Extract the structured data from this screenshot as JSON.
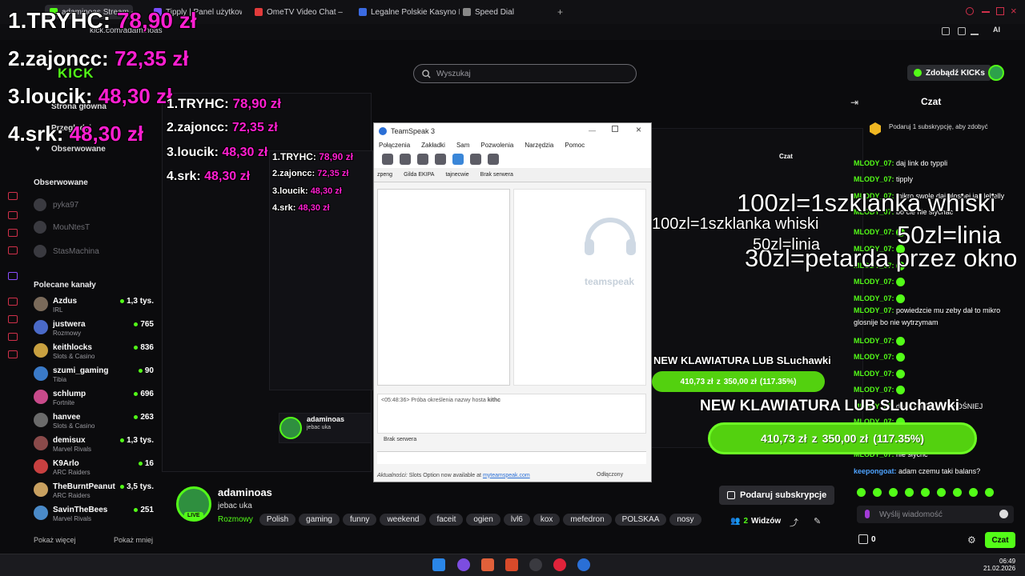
{
  "browser": {
    "tabs": [
      {
        "label": "adaminoas Stream - Wat",
        "color": "#53fc18"
      },
      {
        "label": "Tipply | Panel użytkownik",
        "color": "#7a4dff"
      },
      {
        "label": "OmeTV Video Chat –",
        "color": "#e23b3b"
      },
      {
        "label": "Legalne Polskie Kasyno In",
        "color": "#3b6be2"
      },
      {
        "label": "Speed Dial",
        "color": "#888888"
      }
    ],
    "url": "kick.com/adaminoas"
  },
  "header": {
    "search_placeholder": "Wyszukaj",
    "kicks_button": "Zdobądź KICKs",
    "logo": "KICK",
    "accent": "#53fc18"
  },
  "overlay": {
    "leaderboard": [
      {
        "name": "1.TRYHC:",
        "value": "78,90 zł"
      },
      {
        "name": "2.zajoncc:",
        "value": "72,35 zł"
      },
      {
        "name": "3.loucik:",
        "value": "48,30 zł"
      },
      {
        "name": "4.srk:",
        "value": "48,30 zł"
      }
    ],
    "price_lines": [
      "100zl=1szklanka whiski",
      "50zl=linia",
      "30zl=petarda przez okno"
    ],
    "goal_title": "NEW KLAWIATURA LUB SLuchawki",
    "goal_current": "410,73 zł",
    "goal_sep": "z",
    "goal_target": "350,00 zł",
    "goal_pct": "(117.35%)"
  },
  "sidebar": {
    "nav_home": "Strona główna",
    "nav_browse": "Przeglądaj",
    "nav_following": "Obserwowane",
    "following_header": "Obserwowane",
    "following": [
      "pyka97",
      "MouNtesT",
      "StasMachina"
    ],
    "recommended_header": "Polecane kanały",
    "recommended": [
      {
        "name": "Azdus",
        "cat": "IRL",
        "count": "1,3 tys."
      },
      {
        "name": "justwera",
        "cat": "Rozmowy",
        "count": "765"
      },
      {
        "name": "keithlocks",
        "cat": "Slots & Casino",
        "count": "836"
      },
      {
        "name": "szumi_gaming",
        "cat": "Tibia",
        "count": "90"
      },
      {
        "name": "schlump",
        "cat": "Fortnite",
        "count": "696"
      },
      {
        "name": "hanvee",
        "cat": "Slots & Casino",
        "count": "263"
      },
      {
        "name": "demisux",
        "cat": "Marvel Rivals",
        "count": "1,3 tys."
      },
      {
        "name": "K9Arlo",
        "cat": "ARC Raiders",
        "count": "16"
      },
      {
        "name": "TheBurntPeanut",
        "cat": "ARC Raiders",
        "count": "3,5 tys."
      },
      {
        "name": "SavinTheBees",
        "cat": "Marvel Rivals",
        "count": "251"
      }
    ],
    "show_more": "Pokaż więcej",
    "show_less": "Pokaż mniej"
  },
  "teamspeak": {
    "title": "TeamSpeak 3",
    "menu": [
      "Połączenia",
      "Zakładki",
      "Sam",
      "Pozwolenia",
      "Narzędzia",
      "Pomoc"
    ],
    "tabs": [
      "zpeng",
      "Gilda EKIPA",
      "tajnecwie",
      "Brak serwera"
    ],
    "log_line": "<05:48:36> Próba określenia nazwy hosta",
    "log_host": "kithc",
    "channel_label": "Brak serwera",
    "status_label": "Aktualności:",
    "status_text": "Slots Option now available at",
    "status_link": "myteamspeak.com",
    "status_right": "Odłączony",
    "brand": "teamspeak"
  },
  "chat": {
    "title": "Czat",
    "promo": "Podaruj 1 subskrypcję, aby zdobyć",
    "messages": [
      {
        "user": "MLODY_07:",
        "text": "daj link do typpli"
      },
      {
        "user": "MLODY_07:",
        "text": "tipply"
      },
      {
        "user": "MLODY_07:",
        "text": "mikro swole daj glosnej jak lebelly"
      },
      {
        "user": "MLODY_07:",
        "text": "bo cie nie slychac"
      },
      {
        "user": "MLODY_07:",
        "text": "powiedzcie mu zeby dał to mikro"
      },
      {
        "user": "",
        "text": "glosnije bo nie wytrzymam"
      },
      {
        "user": "MLODY_07:",
        "text": "da LTO MIKRO GŁOŚNIEJ"
      },
      {
        "user": "MLODY_07:",
        "text": "nie słychc"
      },
      {
        "user": "keepongoat:",
        "text": "adam czemu taki balans?"
      }
    ],
    "input_placeholder": "Wyślij wiadomość",
    "send_label": "Czat",
    "points": "0"
  },
  "stream": {
    "streamer": "adaminoas",
    "title": "jebac uka",
    "category": "Rozmowy",
    "tags": [
      "Polish",
      "gaming",
      "funny",
      "weekend",
      "faceit",
      "ogien",
      "lvl6",
      "kox",
      "mefedron",
      "POLSKAA",
      "nosy"
    ],
    "live_badge": "LIVE",
    "sub_button": "Podaruj subskrypcje",
    "viewers": "2",
    "viewers_label": "Widzów"
  },
  "taskbar": {
    "time": "06:49",
    "date": "21.02.2026"
  }
}
